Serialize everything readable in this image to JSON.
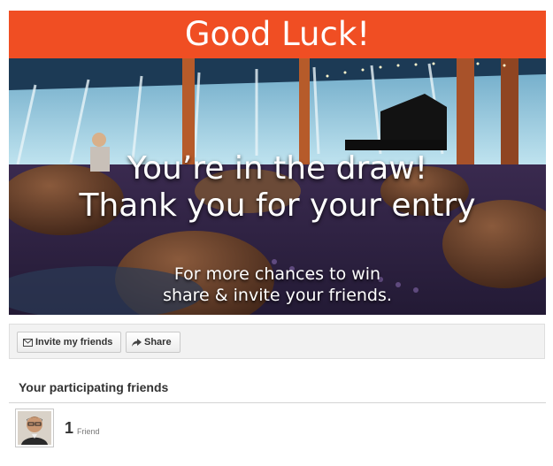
{
  "banner": {
    "title": "Good Luck!",
    "background_color": "#f04e23"
  },
  "hero": {
    "image_description": "cruise ship lounge with grand piano and leather armchairs",
    "headline_line1": "You’re in the draw!",
    "headline_line2": "Thank you for your entry",
    "subline_line1": "For more chances to win",
    "subline_line2": "share & invite your friends."
  },
  "actions": {
    "invite_label": "Invite my friends",
    "invite_icon": "envelope-icon",
    "share_label": "Share",
    "share_icon": "share-arrow-icon"
  },
  "friends": {
    "section_title": "Your participating friends",
    "count": "1",
    "count_label": "Friend"
  }
}
